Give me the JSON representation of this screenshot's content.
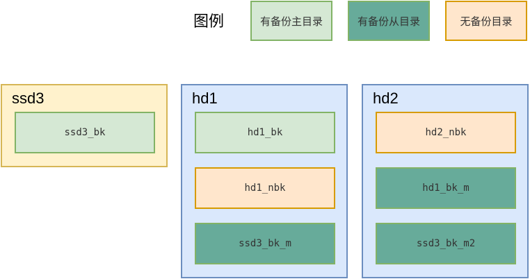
{
  "legend": {
    "title": "图例",
    "items": [
      {
        "label": "有备份主目录",
        "color": "#d5e8d4",
        "border": "#82b366"
      },
      {
        "label": "有备份从目录",
        "color": "#67ab9a",
        "border": "#82b366"
      },
      {
        "label": "无备份目录",
        "color": "#ffe6cc",
        "border": "#d79b00"
      }
    ]
  },
  "containers": [
    {
      "title": "ssd3",
      "color": "#fff2cc",
      "border": "#d6b656",
      "dirs": [
        {
          "label": "ssd3_bk"
        }
      ]
    },
    {
      "title": "hd1",
      "color": "#dae8fc",
      "border": "#6c8ebf",
      "dirs": [
        {
          "label": "hd1_bk"
        },
        {
          "label": "hd1_nbk"
        },
        {
          "label": "ssd3_bk_m"
        }
      ]
    },
    {
      "title": "hd2",
      "color": "#dae8fc",
      "border": "#6c8ebf",
      "dirs": [
        {
          "label": "hd2_nbk"
        },
        {
          "label": "hd1_bk_m"
        },
        {
          "label": "ssd3_bk_m2"
        }
      ]
    }
  ]
}
